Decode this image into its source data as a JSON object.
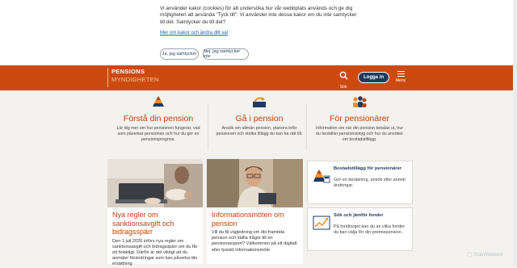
{
  "cookie": {
    "text": "Vi använder kakor (cookies) för att undersöka hur vår webbplats används och ge dig möjligheten att använda \"Tyck till\". Vi använder inte dessa kakor om du inte samtycker till det. Samtycker du till det?",
    "link": "Mer om kakor och ändra ditt val",
    "accept": "Ja, jag samtycker",
    "decline": "Nej, jag samtycker inte"
  },
  "header": {
    "logo_line1": "PENSIONS",
    "logo_line2": "MYNDIGHETEN",
    "search_label": "Sök",
    "login_label": "Logga in",
    "menu_label": "Meny"
  },
  "topics": [
    {
      "title": "Förstå din pension",
      "text": "Lär dig mer om hur pensionen fungerar, vad som påverkar pensionen och hur du gör en pensionsprognos."
    },
    {
      "title": "Gå i pension",
      "text": "Ansök om allmän pension, planera inför pensionen och stolka tillägg du kan ha rätt till."
    },
    {
      "title": "För pensionärer",
      "text": "Information om när din pension betalas ut, hur du beställer pensionsintyg och hur du ansöker om bostadstillägg."
    }
  ],
  "news": [
    {
      "title": "Nya regler om sanktionsavgift och bidragsspärr",
      "text": "Den 1 juli 2026 införs nya regler om sanktionsavgift och bidragsspärr om du får ett felaktigt. Därför är det viktigt att du anmäler förändringar som kan påverka din ersättning"
    },
    {
      "title": "Informationsmöten om pension",
      "text": "Vill du få vägledning om din framtida pension och ställa frågor till en pensionsexpert? Välkommen på ett digitalt eller fysiskt informationsmöte"
    }
  ],
  "services": [
    {
      "title": "Bostadstillägg för pensionärer",
      "text": "Gör en beräkning, ansök eller anmäl ändringar."
    },
    {
      "title": "Sök och jämför fonder",
      "text": "På fondtorget kan du se vilka fonder du kan välja för din premiepension."
    }
  ],
  "watermark": "ScanMalware",
  "colors": {
    "brand": "#cc4a0f",
    "navy": "#1d3a5f"
  }
}
